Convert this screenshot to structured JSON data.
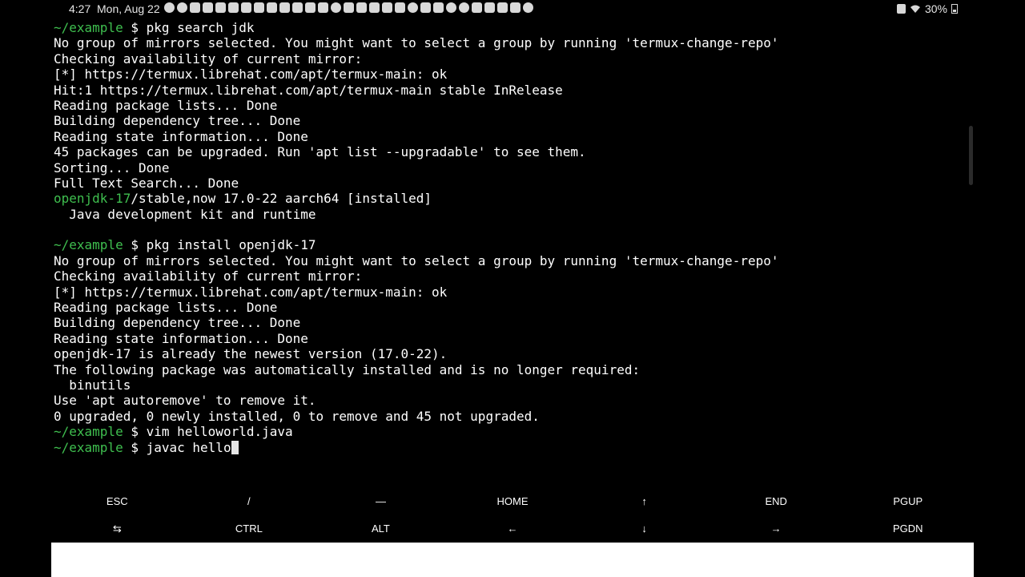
{
  "statusbar": {
    "time": "4:27",
    "date": "Mon, Aug 22",
    "battery": "30%"
  },
  "terminal": {
    "lines": [
      {
        "prompt": "~/example",
        "dollar": " $ ",
        "cmd": "pkg search jdk"
      },
      {
        "text": "No group of mirrors selected. You might want to select a group by running 'termux-change-repo'"
      },
      {
        "text": "Checking availability of current mirror:"
      },
      {
        "text": "[*] https://termux.librehat.com/apt/termux-main: ok"
      },
      {
        "text": "Hit:1 https://termux.librehat.com/apt/termux-main stable InRelease"
      },
      {
        "text": "Reading package lists... Done"
      },
      {
        "text": "Building dependency tree... Done"
      },
      {
        "text": "Reading state information... Done"
      },
      {
        "text": "45 packages can be upgraded. Run 'apt list --upgradable' to see them."
      },
      {
        "text": "Sorting... Done"
      },
      {
        "text": "Full Text Search... Done"
      },
      {
        "pkg": "openjdk-17",
        "rest": "/stable,now 17.0-22 aarch64 [installed]"
      },
      {
        "text": "  Java development kit and runtime"
      },
      {
        "text": ""
      },
      {
        "prompt": "~/example",
        "dollar": " $ ",
        "cmd": "pkg install openjdk-17"
      },
      {
        "text": "No group of mirrors selected. You might want to select a group by running 'termux-change-repo'"
      },
      {
        "text": "Checking availability of current mirror:"
      },
      {
        "text": "[*] https://termux.librehat.com/apt/termux-main: ok"
      },
      {
        "text": "Reading package lists... Done"
      },
      {
        "text": "Building dependency tree... Done"
      },
      {
        "text": "Reading state information... Done"
      },
      {
        "text": "openjdk-17 is already the newest version (17.0-22)."
      },
      {
        "text": "The following package was automatically installed and is no longer required:"
      },
      {
        "text": "  binutils"
      },
      {
        "text": "Use 'apt autoremove' to remove it."
      },
      {
        "text": "0 upgraded, 0 newly installed, 0 to remove and 45 not upgraded."
      },
      {
        "prompt": "~/example",
        "dollar": " $ ",
        "cmd": "vim helloworld.java"
      },
      {
        "prompt": "~/example",
        "dollar": " $ ",
        "cmd": "javac hello",
        "cursor": true
      }
    ]
  },
  "extra_keys": {
    "row1": [
      "ESC",
      "/",
      "—",
      "HOME",
      "↑",
      "END",
      "PGUP"
    ],
    "row2": [
      "⇆",
      "CTRL",
      "ALT",
      "←",
      "↓",
      "→",
      "PGDN"
    ]
  }
}
